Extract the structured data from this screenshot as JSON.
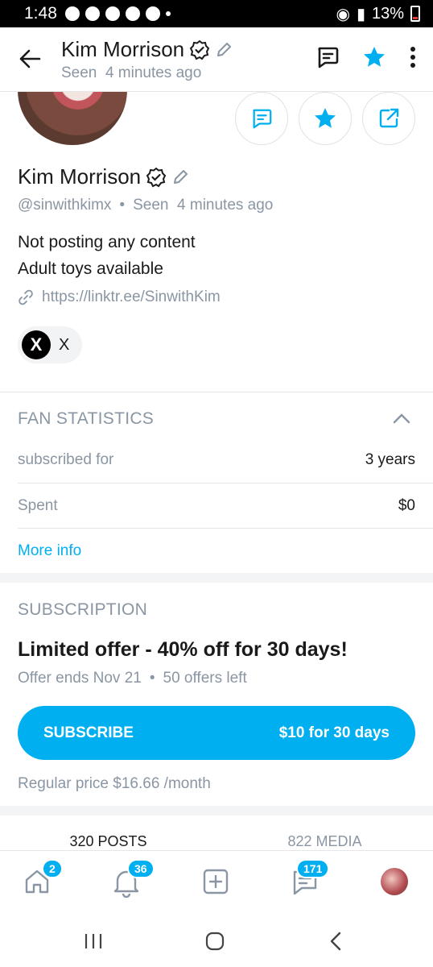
{
  "status_bar": {
    "time": "1:48",
    "battery": "13%"
  },
  "header": {
    "title": "Kim Morrison",
    "seen": "Seen",
    "seen_time": "4 minutes ago"
  },
  "profile": {
    "name": "Kim Morrison",
    "handle": "@sinwithkimx",
    "seen": "Seen",
    "seen_time": "4 minutes ago",
    "bio_line1": "Not posting any content",
    "bio_line2": "Adult toys available",
    "link": "https://linktr.ee/SinwithKim",
    "social_label": "X",
    "social_glyph": "X"
  },
  "fan_statistics": {
    "title": "FAN STATISTICS",
    "rows": [
      {
        "label": "subscribed for",
        "value": "3 years"
      },
      {
        "label": "Spent",
        "value": "$0"
      }
    ],
    "more_info": "More info"
  },
  "subscription": {
    "title": "SUBSCRIPTION",
    "offer_title": "Limited offer - 40% off for 30 days!",
    "offer_ends": "Offer ends Nov 21",
    "offers_left": "50 offers left",
    "button_left": "SUBSCRIBE",
    "button_right": "$10 for 30 days",
    "regular_price": "Regular price $16.66 /month"
  },
  "tabs": [
    {
      "label": "320 POSTS"
    },
    {
      "label": "822 MEDIA"
    }
  ],
  "bottom_nav": {
    "home_badge": "2",
    "notifications_badge": "36",
    "messages_badge": "171"
  },
  "colors": {
    "accent": "#00aff0",
    "muted": "#8a96a3"
  }
}
